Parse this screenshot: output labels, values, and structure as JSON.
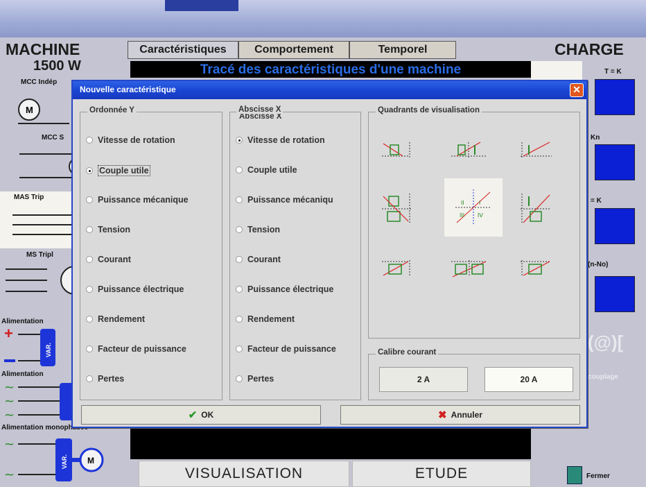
{
  "header": {
    "machine_title": "MACHINE",
    "power": "1500 W",
    "charge_title": "CHARGE"
  },
  "tabs": [
    {
      "label": "Caractéristiques"
    },
    {
      "label": "Comportement"
    },
    {
      "label": "Temporel"
    }
  ],
  "banner": "Tracé des caractéristiques d'une machine",
  "left_panel": {
    "items": [
      {
        "label": "MCC Indép"
      },
      {
        "label": "MCC S"
      },
      {
        "label": "MAS Trip"
      },
      {
        "label": "MS Tripl"
      }
    ],
    "sources": [
      {
        "label": "Alimentation"
      },
      {
        "label": "Alimentation"
      },
      {
        "label": "Alimentation monophasée"
      }
    ],
    "var_label": "VAR.",
    "motor_label": "M"
  },
  "right_panel": {
    "labels": [
      "T = K",
      "Kn",
      "= K",
      "(n-No)"
    ],
    "couplage": "couplage",
    "close_label": "Fermer"
  },
  "bottom": {
    "visualisation": "VISUALISATION",
    "etude": "ETUDE"
  },
  "dialog": {
    "title": "Nouvelle caractéristique",
    "ordinate": {
      "title": "Ordonnée Y",
      "selected": "Couple utile",
      "options": [
        "Vitesse de rotation",
        "Couple utile",
        "Puissance mécanique",
        "Tension",
        "Courant",
        "Puissance électrique",
        "Rendement",
        "Facteur de puissance",
        "Pertes"
      ]
    },
    "abscissa": {
      "title": "Abscisse X",
      "selected": "Vitesse de rotation",
      "options": [
        "Vitesse de rotation",
        "Couple utile",
        "Puissance mécaniqu",
        "Tension",
        "Courant",
        "Puissance électrique",
        "Rendement",
        "Facteur de puissance",
        "Pertes"
      ]
    },
    "quadrants": {
      "title": "Quadrants de visualisation",
      "selected_index": 4
    },
    "calibre": {
      "title": "Calibre courant",
      "options": [
        "2 A",
        "20 A"
      ],
      "selected": "20 A"
    },
    "ok_label": "OK",
    "cancel_label": "Annuler"
  },
  "colors": {
    "title_blue": "#1a47d4",
    "banner_text": "#2b6de6",
    "ok_green": "#2e9a2e",
    "cancel_red": "#d22020"
  }
}
